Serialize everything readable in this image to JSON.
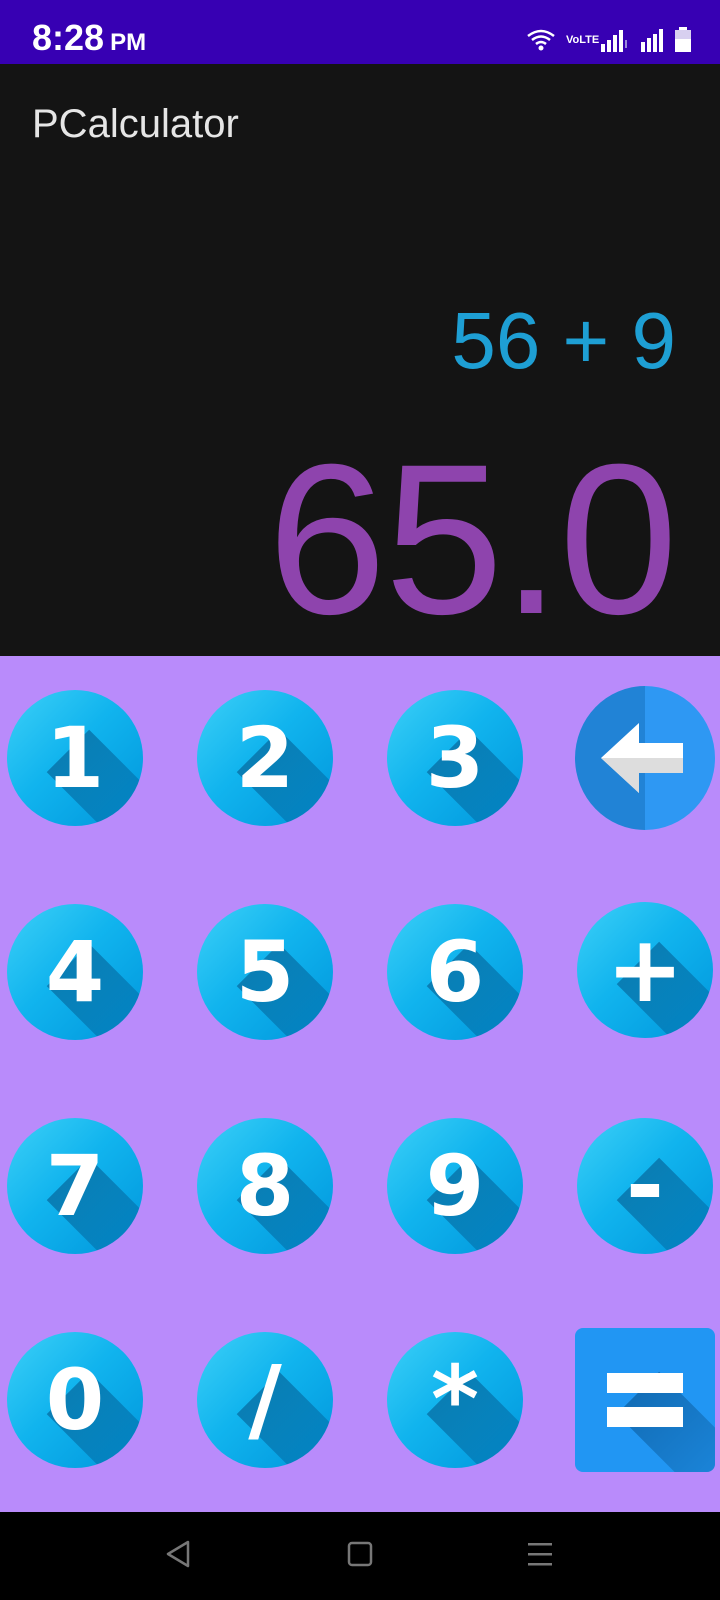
{
  "status_bar": {
    "time": "8:28",
    "ampm": "PM",
    "volte": "VoLTE"
  },
  "app": {
    "title": "PCalculator"
  },
  "display": {
    "expression": "56 + 9",
    "result": "65.0"
  },
  "keypad": {
    "keys": [
      {
        "label": "1"
      },
      {
        "label": "2"
      },
      {
        "label": "3"
      },
      {
        "label": "backspace"
      },
      {
        "label": "4"
      },
      {
        "label": "5"
      },
      {
        "label": "6"
      },
      {
        "label": "+"
      },
      {
        "label": "7"
      },
      {
        "label": "8"
      },
      {
        "label": "9"
      },
      {
        "label": "-"
      },
      {
        "label": "0"
      },
      {
        "label": "/"
      },
      {
        "label": "*"
      },
      {
        "label": "="
      }
    ]
  },
  "colors": {
    "status_bar": "#3700b3",
    "display_bg": "#141414",
    "keypad_bg": "#b98bfb",
    "expression": "#1e9fd4",
    "result": "#8e44ad",
    "key": "#0aa6e8",
    "equals": "#2196f3"
  },
  "icons": {
    "wifi": "wifi-icon",
    "signal": "signal-icon",
    "battery": "battery-icon",
    "back": "nav-back-icon",
    "home": "nav-home-icon",
    "menu": "nav-menu-icon",
    "backspace": "backspace-arrow-icon",
    "equals": "equals-icon"
  }
}
